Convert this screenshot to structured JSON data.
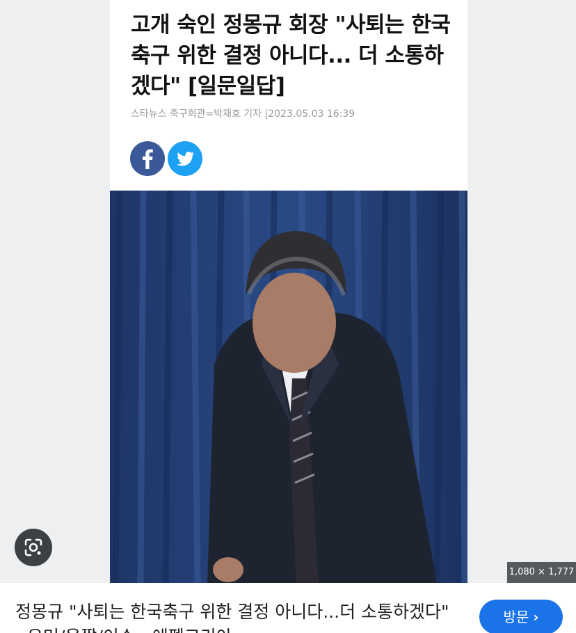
{
  "article": {
    "headline": "고개 숙인 정몽규 회장 \"사퇴는 한국 축구 위한 결정 아니다... 더 소통하겠다\" [일문일답]",
    "byline": "스타뉴스 축구회관=박재호 기자 |2023.05.03 16:39",
    "share": {
      "facebook_icon": "facebook-icon",
      "twitter_icon": "twitter-icon"
    },
    "photo_icon": "person-bowing-photo"
  },
  "viewer": {
    "image_dimensions": "1,080 × 1,777",
    "lens_icon": "lens-icon"
  },
  "result": {
    "title": "정몽규 \"사퇴는 한국축구 위한 결정 아니다...더 소통하겠다\" - 유머/움짤/이슈 - 에펨코리아",
    "visit_label": "방문",
    "visit_icon": "chevron-right-icon",
    "accent_color": "#1a73e8"
  }
}
